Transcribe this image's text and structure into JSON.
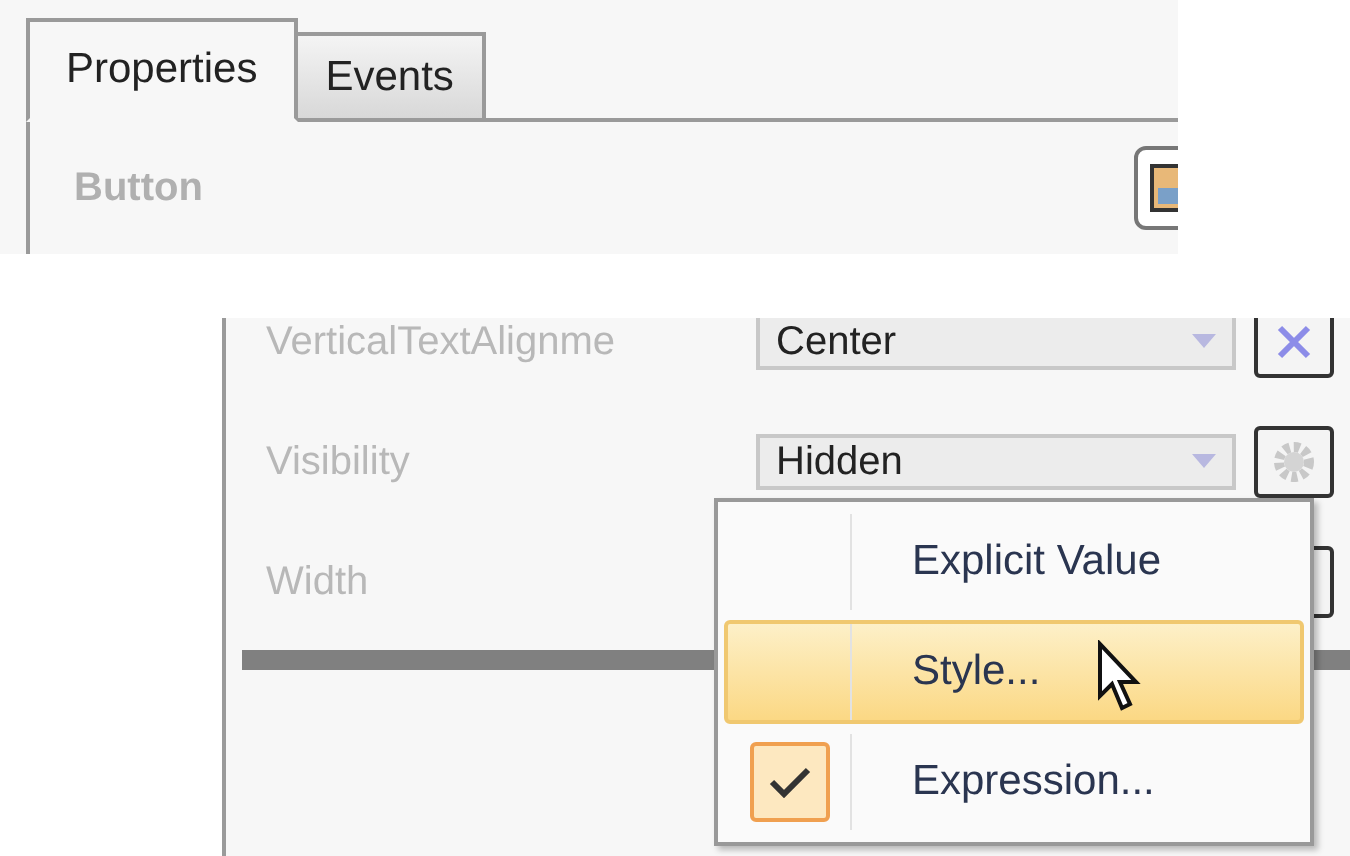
{
  "tabs": [
    {
      "label": "Properties",
      "selected": true
    },
    {
      "label": "Events",
      "selected": false
    }
  ],
  "header": {
    "title": "Button"
  },
  "properties": [
    {
      "name": "VerticalTextAlignme",
      "value": "Center",
      "kind": "clear"
    },
    {
      "name": "Visibility",
      "value": "Hidden",
      "kind": "gear"
    },
    {
      "name": "Width",
      "kind": "plain"
    }
  ],
  "menu": [
    {
      "label": "Explicit Value",
      "selected": false,
      "checked": false
    },
    {
      "label": "Style...",
      "selected": true,
      "checked": false
    },
    {
      "label": "Expression...",
      "selected": false,
      "checked": true
    }
  ]
}
